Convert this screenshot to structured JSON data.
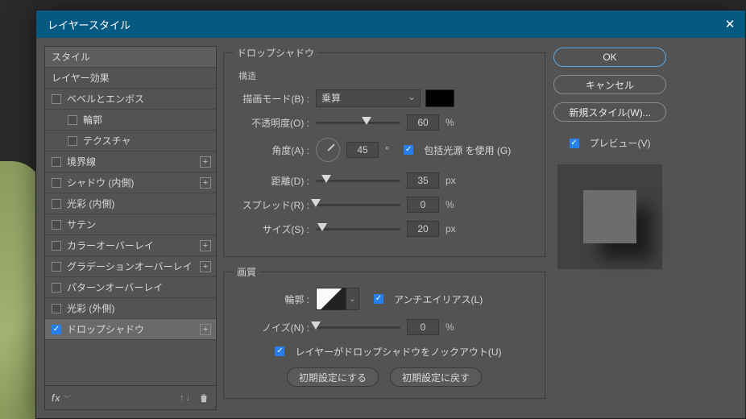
{
  "dialog": {
    "title": "レイヤースタイル"
  },
  "sidebar": {
    "styles_header": "スタイル",
    "layer_effects": "レイヤー効果",
    "bevel_emboss": "ベベルとエンボス",
    "contour": "輪郭",
    "texture": "テクスチャ",
    "stroke": "境界線",
    "inner_shadow": "シャドウ (内側)",
    "inner_glow": "光彩 (内側)",
    "satin": "サテン",
    "color_overlay": "カラーオーバーレイ",
    "gradient_overlay": "グラデーションオーバーレイ",
    "pattern_overlay": "パターンオーバーレイ",
    "outer_glow": "光彩 (外側)",
    "drop_shadow": "ドロップシャドウ",
    "fx_label": "fx"
  },
  "panel": {
    "legend": "ドロップシャドウ",
    "structure_header": "構造",
    "blend_mode_label": "描画モード(B) :",
    "blend_mode_value": "乗算",
    "opacity_label": "不透明度(O) :",
    "opacity_value": "60",
    "opacity_unit": "%",
    "angle_label": "角度(A) :",
    "angle_value": "45",
    "angle_deg": "°",
    "global_light_label": "包括光源 を使用 (G)",
    "distance_label": "距離(D) :",
    "distance_value": "35",
    "distance_unit": "px",
    "spread_label": "スプレッド(R) :",
    "spread_value": "0",
    "spread_unit": "%",
    "size_label": "サイズ(S) :",
    "size_value": "20",
    "size_unit": "px",
    "quality_legend": "画質",
    "contour_label": "輪郭 :",
    "antialias_label": "アンチエイリアス(L)",
    "noise_label": "ノイズ(N) :",
    "noise_value": "0",
    "noise_unit": "%",
    "knockout_label": "レイヤーがドロップシャドウをノックアウト(U)",
    "make_default": "初期設定にする",
    "reset_default": "初期設定に戻す"
  },
  "buttons": {
    "ok": "OK",
    "cancel": "キャンセル",
    "new_style": "新規スタイル(W)...",
    "preview": "プレビュー(V)"
  }
}
